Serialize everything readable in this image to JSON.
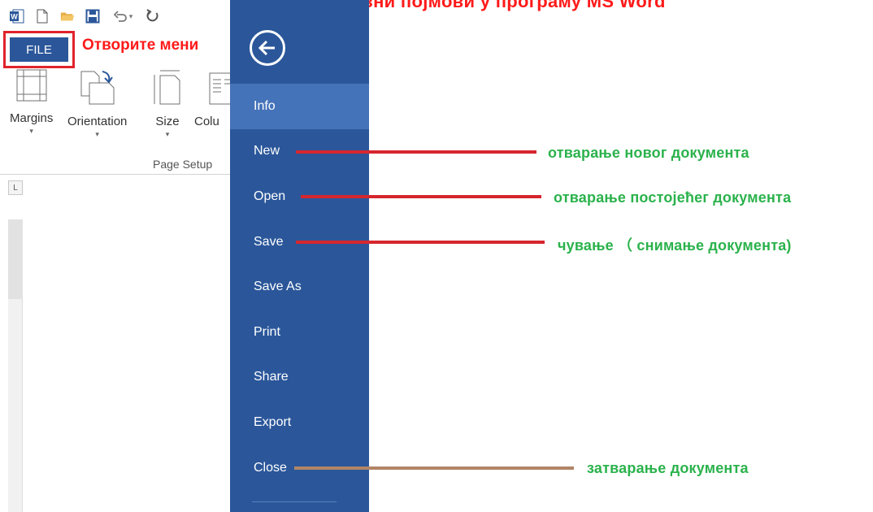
{
  "page_title": "Основни појмови у програму MS Word",
  "quick_access": {
    "icons": [
      "word-logo-icon",
      "new-document-icon",
      "open-folder-icon",
      "save-icon",
      "undo-icon",
      "redo-icon"
    ],
    "undo_caret": "▾"
  },
  "file_tab": {
    "label": "FILE"
  },
  "annotation_open_menu": "Отворите мени",
  "ribbon": {
    "buttons": [
      {
        "label": "Margins",
        "caret": "▾"
      },
      {
        "label": "Orientation",
        "caret": "▾"
      },
      {
        "label": "Size",
        "caret": "▾"
      },
      {
        "label": "Colu",
        "caret": ""
      }
    ],
    "group_label": "Page Setup"
  },
  "ruler": {
    "tab_selector_glyph": "L"
  },
  "backstage": {
    "menu_items": [
      {
        "label": "Info",
        "selected": true
      },
      {
        "label": "New",
        "selected": false
      },
      {
        "label": "Open",
        "selected": false
      },
      {
        "label": "Save",
        "selected": false
      },
      {
        "label": "Save As",
        "selected": false
      },
      {
        "label": "Print",
        "selected": false
      },
      {
        "label": "Share",
        "selected": false
      },
      {
        "label": "Export",
        "selected": false
      },
      {
        "label": "Close",
        "selected": false
      }
    ]
  },
  "annotations": {
    "new": "отварање новог документа",
    "open": "отварање постојећег документа",
    "save": "чување （ снимање документа)",
    "close": "затварање документа"
  },
  "colors": {
    "backstage_blue": "#2b579a",
    "selected_item": "#4573b9",
    "red_accent": "#e0232b",
    "annotation_green": "#2bb24c",
    "close_line_brown": "#b18566"
  }
}
